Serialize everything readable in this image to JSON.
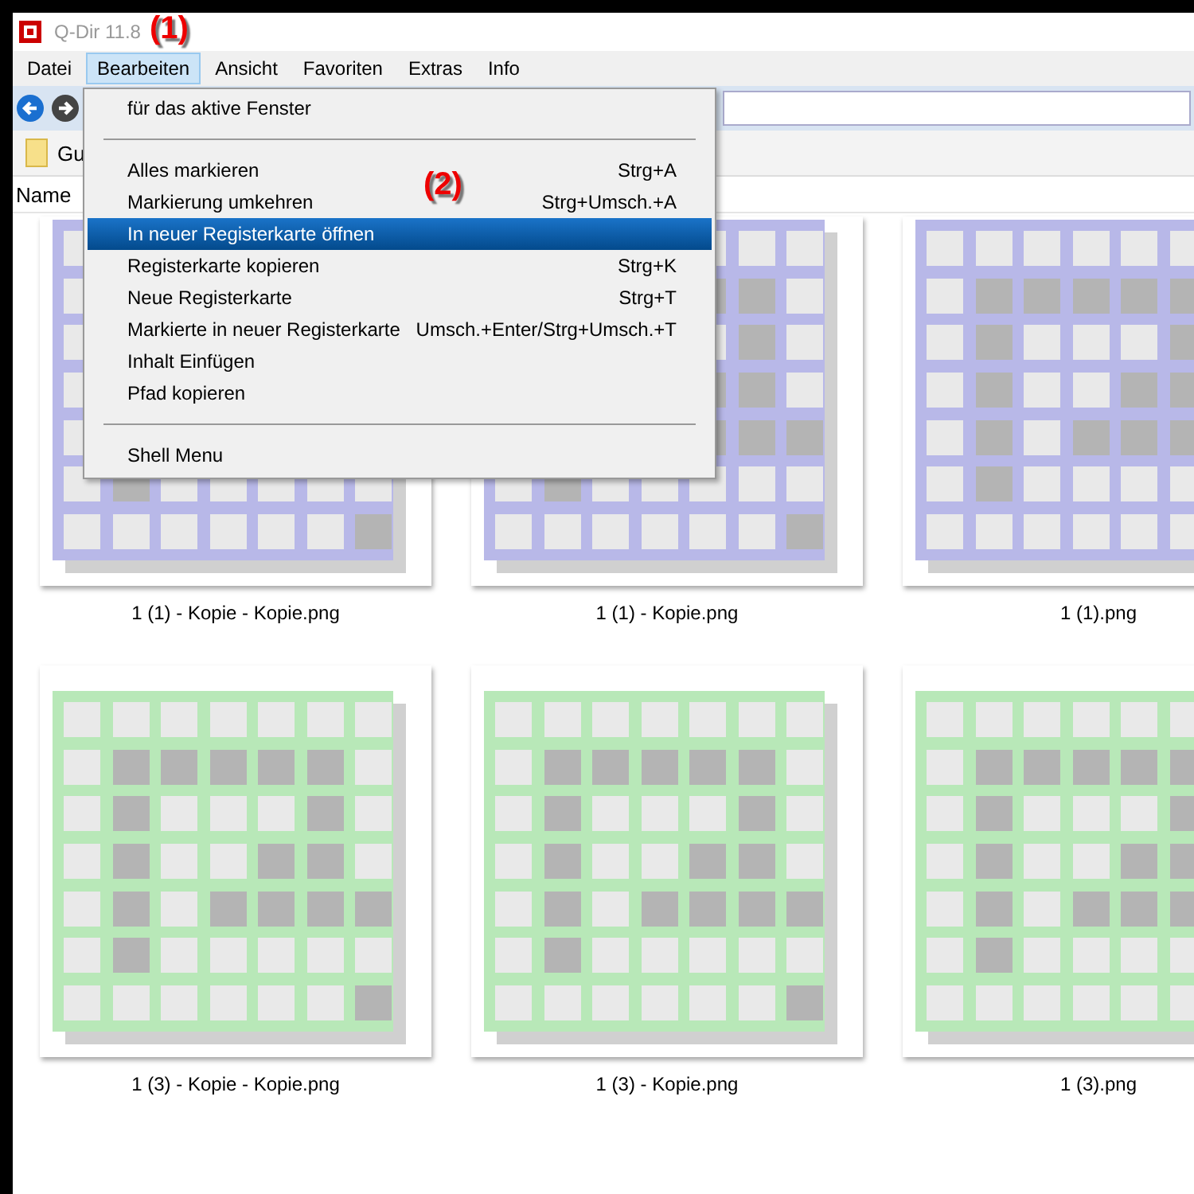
{
  "window": {
    "title": "Q-Dir 11.8"
  },
  "menu_bar": [
    {
      "label": "Datei",
      "selected": false
    },
    {
      "label": "Bearbeiten",
      "selected": true
    },
    {
      "label": "Ansicht",
      "selected": false
    },
    {
      "label": "Favoriten",
      "selected": false
    },
    {
      "label": "Extras",
      "selected": false
    },
    {
      "label": "Info",
      "selected": false
    }
  ],
  "tab": {
    "label": "Gu"
  },
  "column_header": {
    "label": "Name"
  },
  "dropdown_menu": [
    {
      "kind": "item",
      "label": "für das aktive Fenster",
      "selected": false
    },
    {
      "kind": "separator"
    },
    {
      "kind": "item",
      "label": "Alles markieren",
      "shortcut": "Strg+A",
      "selected": false
    },
    {
      "kind": "item",
      "label": "Markierung umkehren",
      "shortcut": "Strg+Umsch.+A",
      "selected": false
    },
    {
      "kind": "item",
      "label": "In neuer Registerkarte öffnen",
      "selected": true
    },
    {
      "kind": "item",
      "label": "Registerkarte kopieren",
      "shortcut": "Strg+K",
      "selected": false
    },
    {
      "kind": "item",
      "label": "Neue Registerkarte",
      "shortcut": "Strg+T",
      "selected": false
    },
    {
      "kind": "item",
      "label": "Markierte in neuer Registerkarte",
      "shortcut": "Umsch.+Enter/Strg+Umsch.+T",
      "selected": false
    },
    {
      "kind": "item",
      "label": "Inhalt Einfügen",
      "selected": false
    },
    {
      "kind": "item",
      "label": "Pfad kopieren",
      "selected": false
    },
    {
      "kind": "separator"
    },
    {
      "kind": "item",
      "label": "Shell Menu",
      "selected": false
    }
  ],
  "files": [
    {
      "name": "1 (1) - Kopie - Kopie.png",
      "color": "#b8b8e8"
    },
    {
      "name": "1 (1) - Kopie.png",
      "color": "#b8b8e8"
    },
    {
      "name": "1 (1).png",
      "color": "#b8b8e8"
    },
    {
      "name": "1 (3) - Kopie - Kopie.png",
      "color": "#b8e8b8"
    },
    {
      "name": "1 (3) - Kopie.png",
      "color": "#b8e8b8"
    },
    {
      "name": "1 (3).png",
      "color": "#b8e8b8"
    }
  ],
  "annotations": [
    "(1)",
    "(2)"
  ]
}
